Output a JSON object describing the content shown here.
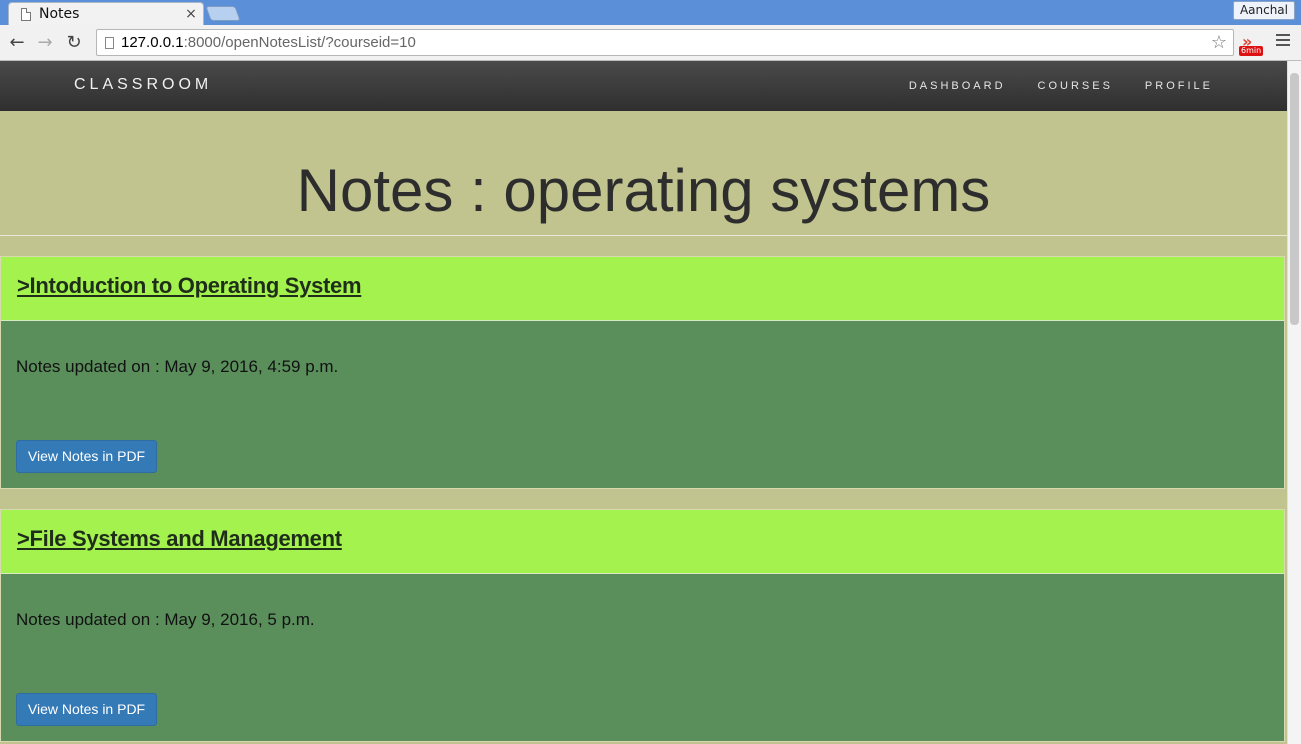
{
  "browser": {
    "tab_title": "Notes",
    "tab_close": "×",
    "profile_name": "Aanchal",
    "url_host": "127.0.0.1",
    "url_rest": ":8000/openNotesList/?courseid=10",
    "extension_badge": "6min"
  },
  "site": {
    "brand": "CLASSROOM",
    "nav": [
      "DASHBOARD",
      "COURSES",
      "PROFILE"
    ]
  },
  "page": {
    "title": "Notes : operating systems"
  },
  "notes": [
    {
      "title": ">Intoduction to Operating System",
      "updated": "Notes updated on : May 9, 2016, 4:59 p.m.",
      "button": "View Notes in PDF"
    },
    {
      "title": ">File Systems and Management",
      "updated": "Notes updated on : May 9, 2016, 5 p.m.",
      "button": "View Notes in PDF"
    }
  ],
  "colors": {
    "page_bg": "#c1c48f",
    "card_header": "#a4f24d",
    "card_body": "#5a8f5c",
    "button": "#337ab7"
  }
}
